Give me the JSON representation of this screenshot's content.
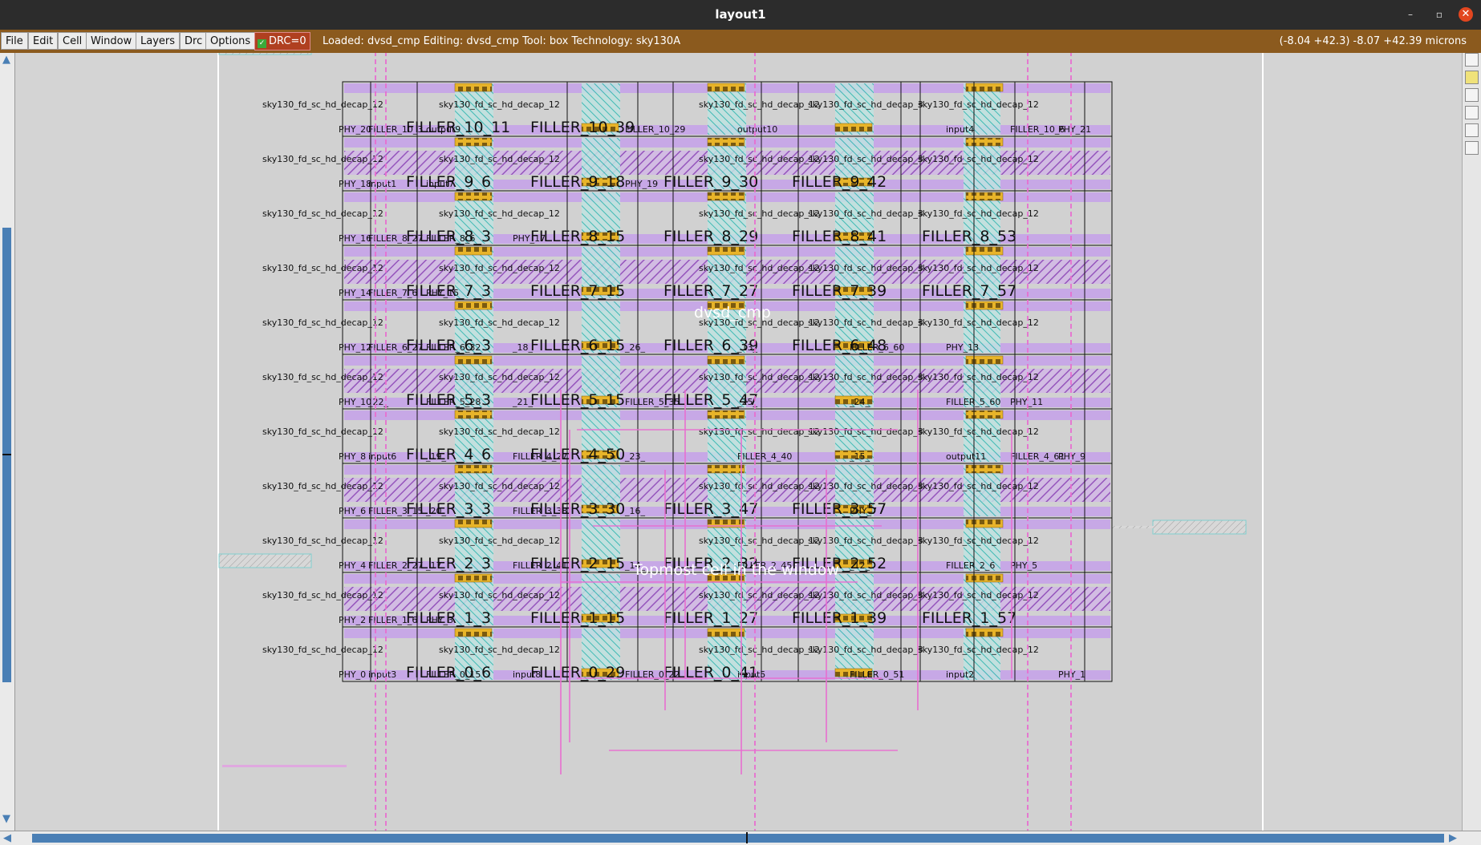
{
  "window": {
    "title": "layout1",
    "controls": {
      "minimize": "–",
      "maximize": "▫",
      "close": "✕"
    }
  },
  "menu": {
    "items": [
      "File",
      "Edit",
      "Cell",
      "Window",
      "Layers",
      "Drc",
      "Options"
    ],
    "drc_label": "DRC=0",
    "status": "Loaded: dvsd_cmp Editing: dvsd_cmp Tool: box  Technology: sky130A",
    "coords": "(-8.04 +42.3) -8.07 +42.39 microns"
  },
  "layout": {
    "cell_name": "dvsd_cmp",
    "top_cell_overlay": "Topmost cell in the window",
    "rows": [
      {
        "decap_labels": [
          "sky130_fd_sc_hd_decap_12",
          "sky130_fd_sc_hd_decap_12",
          "sky130_fd_sc_hd_decap_12",
          "sky130_fd_sc_hd_decap_12",
          "sky130_fd_sc_hd_decap_3"
        ],
        "instances": [
          "PHY_20",
          "FILLER_10_3",
          "output9",
          "FILLER_10_11",
          "FILLER_10_29",
          "output10",
          "FILLER_10_39",
          "input4",
          "FILLER_10_6",
          "PHY_21"
        ],
        "big": [
          "FILLER_10_11",
          "FILLER_10_39"
        ]
      },
      {
        "decap_labels": [
          "sky130_fd_sc_hd_decap_12",
          "sky130_fd_sc_hd_decap_12",
          "sky130_fd_sc_hd_decap_12",
          "sky130_fd_sc_hd_decap_12",
          "sky130_fd_sc_hd_decap_3"
        ],
        "instances": [
          "PHY_18",
          "input1",
          "input7",
          "FILLER_9_6",
          "PHY_19"
        ],
        "big": [
          "FILLER_9_6",
          "FILLER_9_18",
          "FILLER_9_30",
          "FILLER_9_42"
        ]
      },
      {
        "decap_labels": [
          "sky130_fd_sc_hd_decap_12",
          "sky130_fd_sc_hd_decap_12",
          "sky130_fd_sc_hd_decap_12",
          "sky130_fd_sc_hd_decap_12",
          "sky130_fd_sc_hd_decap_3"
        ],
        "instances": [
          "PHY_16",
          "FILLER_8_27",
          "FILLER_8_6",
          "PHY_17"
        ],
        "big": [
          "FILLER_8_3",
          "FILLER_8_15",
          "FILLER_8_29",
          "FILLER_8_41",
          "FILLER_8_53"
        ]
      },
      {
        "decap_labels": [
          "sky130_fd_sc_hd_decap_12",
          "sky130_fd_sc_hd_decap_12",
          "sky130_fd_sc_hd_decap_12",
          "sky130_fd_sc_hd_decap_12",
          "sky130_fd_sc_hd_decap_3"
        ],
        "instances": [
          "PHY_14",
          "FILLER_7_6",
          "PHY_15"
        ],
        "big": [
          "FILLER_7_3",
          "FILLER_7_15",
          "FILLER_7_27",
          "FILLER_7_39",
          "FILLER_7_57"
        ]
      },
      {
        "decap_labels": [
          "sky130_fd_sc_hd_decap_12",
          "sky130_fd_sc_hd_decap_12",
          "sky130_fd_sc_hd_decap_12",
          "sky130_fd_sc_hd_decap_12",
          "sky130_fd_sc_hd_decap_3"
        ],
        "instances": [
          "PHY_12",
          "FILLER_6_27",
          "FILLER_6_32",
          "_18_",
          "_26_",
          "_13_",
          "FILLER_6_60",
          "PHY_13"
        ],
        "big": [
          "FILLER_6_3",
          "FILLER_6_15",
          "FILLER_6_39",
          "FILLER_6_48"
        ]
      },
      {
        "decap_labels": [
          "sky130_fd_sc_hd_decap_12",
          "sky130_fd_sc_hd_decap_12",
          "sky130_fd_sc_hd_decap_12",
          "sky130_fd_sc_hd_decap_12",
          "sky130_fd_sc_hd_decap_3"
        ],
        "instances": [
          "PHY_10",
          "_22_",
          "FILLER_5_28",
          "_21_",
          "FILLER_5_35",
          "_25_",
          "_24_",
          "FILLER_5_60",
          "PHY_11"
        ],
        "big": [
          "FILLER_5_3",
          "FILLER_5_15",
          "FILLER_5_47"
        ]
      },
      {
        "decap_labels": [
          "sky130_fd_sc_hd_decap_12",
          "sky130_fd_sc_hd_decap_12",
          "sky130_fd_sc_hd_decap_12",
          "sky130_fd_sc_hd_decap_12",
          "sky130_fd_sc_hd_decap_3"
        ],
        "instances": [
          "PHY_8",
          "input6",
          "_19_",
          "FILLER_4_27",
          "_23_",
          "FILLER_4_40",
          "_15_",
          "output11",
          "FILLER_4_61",
          "PHY_9"
        ],
        "big": [
          "FILLER_4_6",
          "FILLER_4_50"
        ]
      },
      {
        "decap_labels": [
          "sky130_fd_sc_hd_decap_12",
          "sky130_fd_sc_hd_decap_12",
          "sky130_fd_sc_hd_decap_12",
          "sky130_fd_sc_hd_decap_12",
          "sky130_fd_sc_hd_decap_3"
        ],
        "instances": [
          "PHY_6",
          "FILLER_3_15",
          "_20_",
          "FILLER_3_38",
          "_16_",
          "FILLER_3_57",
          "PHY_7"
        ],
        "big": [
          "FILLER_3_3",
          "FILLER_3_30",
          "FILLER_3_47",
          "FILLER_3_57"
        ]
      },
      {
        "decap_labels": [
          "sky130_fd_sc_hd_decap_12",
          "sky130_fd_sc_hd_decap_12",
          "sky130_fd_sc_hd_decap_12",
          "sky130_fd_sc_hd_decap_12",
          "sky130_fd_sc_hd_decap_3"
        ],
        "instances": [
          "PHY_4",
          "FILLER_2_27",
          "_17_",
          "FILLER_2_41",
          "_14_",
          "FILLER_2_45",
          "_12_",
          "FILLER_2_6",
          "PHY_5"
        ],
        "big": [
          "FILLER_2_3",
          "FILLER_2_15",
          "FILLER_2_32",
          "FILLER_2_52"
        ]
      },
      {
        "decap_labels": [
          "sky130_fd_sc_hd_decap_12",
          "sky130_fd_sc_hd_decap_12",
          "sky130_fd_sc_hd_decap_12",
          "sky130_fd_sc_hd_decap_12",
          "sky130_fd_sc_hd_decap_3"
        ],
        "instances": [
          "PHY_2",
          "FILLER_1_6",
          "PHY_3"
        ],
        "big": [
          "FILLER_1_3",
          "FILLER_1_15",
          "FILLER_1_27",
          "FILLER_1_39",
          "FILLER_1_57"
        ]
      },
      {
        "decap_labels": [
          "sky130_fd_sc_hd_decap_12",
          "sky130_fd_sc_hd_decap_12",
          "sky130_fd_sc_hd_decap_12",
          "sky130_fd_sc_hd_decap_12",
          "sky130_fd_sc_hd_decap_3"
        ],
        "instances": [
          "PHY_0",
          "input3",
          "FILLER_0_15",
          "input8",
          "FILLER_0_22",
          "input5",
          "FILLER_0_51",
          "input2",
          "FILLER_0_6",
          "PHY_1"
        ],
        "big": [
          "FILLER_0_6",
          "FILLER_0_29",
          "FILLER_0_41"
        ]
      }
    ]
  },
  "colors": {
    "titlebar": "#2c2c2c",
    "menubar": "#8b5a1e",
    "canvas": "#d4d4d4",
    "boundary": "#ffffff",
    "metal1": "#b48ee0",
    "nwell": "#9b4ec8",
    "li": "#27b6b0",
    "via": "#e8b429",
    "poly": "#e86fd0",
    "scroll": "#4a7fb5"
  },
  "icons": {
    "scroll_up": "arrow-up-icon",
    "scroll_down": "arrow-down-icon",
    "scroll_left": "arrow-left-icon",
    "scroll_right": "arrow-right-icon",
    "close": "close-icon"
  }
}
